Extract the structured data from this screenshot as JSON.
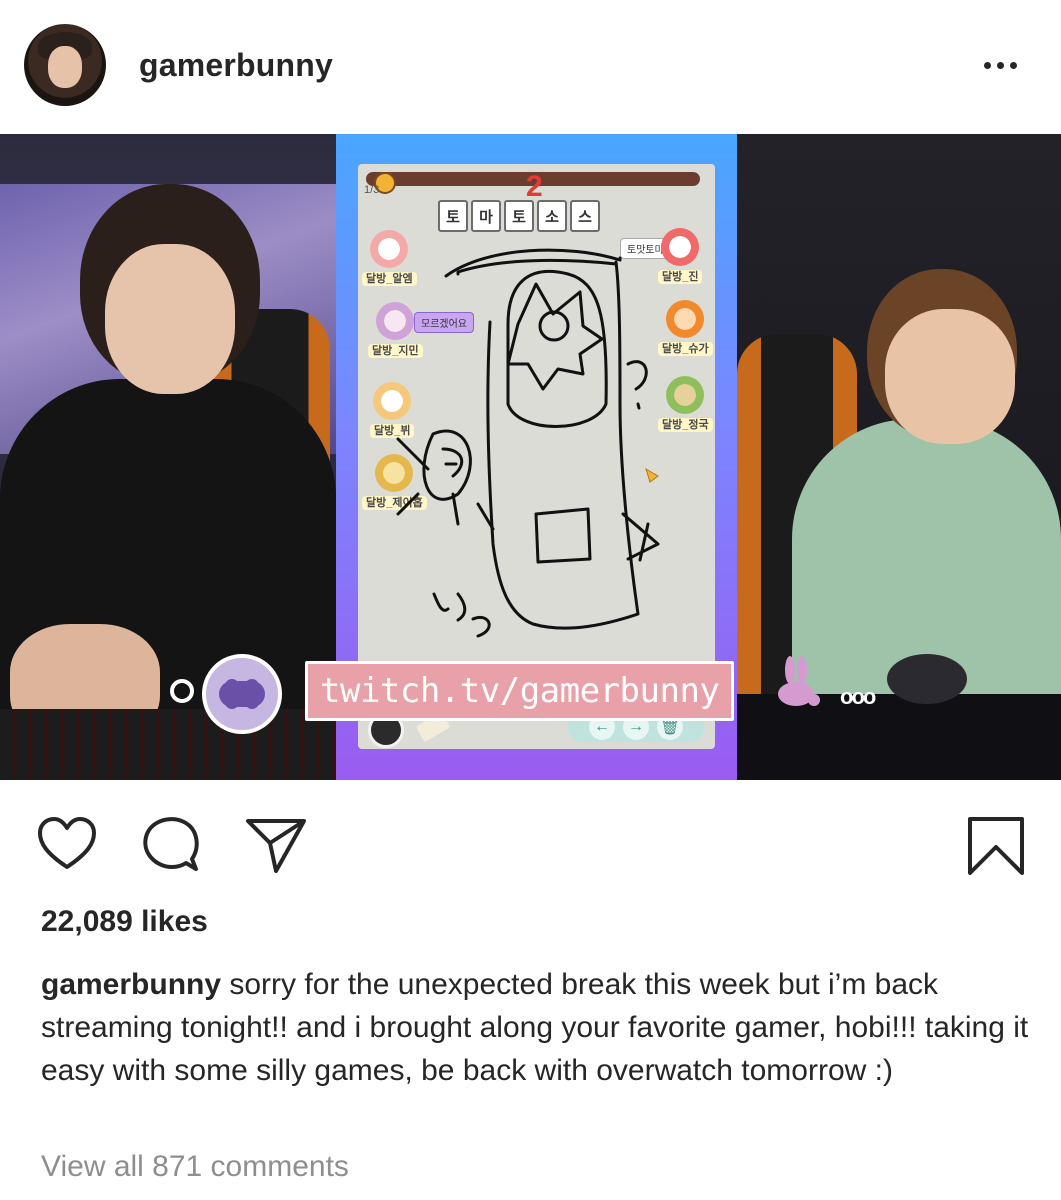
{
  "post": {
    "username": "gamerbunny",
    "more_icon": "more-horizontal-icon"
  },
  "media": {
    "game": {
      "round_number": "2",
      "round_fraction": "1/3",
      "answer_tiles": [
        "토",
        "마",
        "토",
        "소",
        "스"
      ],
      "players_left": [
        {
          "name": "달방_알엠"
        },
        {
          "name": "달방_지민"
        },
        {
          "name": "달방_뷔"
        },
        {
          "name": "달방_제이홉"
        }
      ],
      "players_right": [
        {
          "name": "달방_진"
        },
        {
          "name": "달방_슈가"
        },
        {
          "name": "달방_정국"
        }
      ],
      "speech_left": "모르겠어요",
      "speech_right": "토맛토마토"
    },
    "overlay_link": "twitch.tv/gamerbunny",
    "overlay_dots": "ooo"
  },
  "actions": {
    "like_icon": "heart-icon",
    "comment_icon": "comment-icon",
    "share_icon": "paper-plane-icon",
    "save_icon": "bookmark-icon"
  },
  "likes": "22,089 likes",
  "caption": {
    "username": "gamerbunny",
    "text": " sorry for the unexpected break this week but i’m back streaming tonight!! and i brought along your favorite gamer, hobi!!! taking it easy with some silly games, be back with overwatch tomorrow :)"
  },
  "view_comments": "View all 871 comments",
  "colors": {
    "text": "#262626",
    "muted": "#8e8e8e",
    "overlay_pink": "#e8a1a8",
    "overlay_purple": "#c6b6e2"
  }
}
